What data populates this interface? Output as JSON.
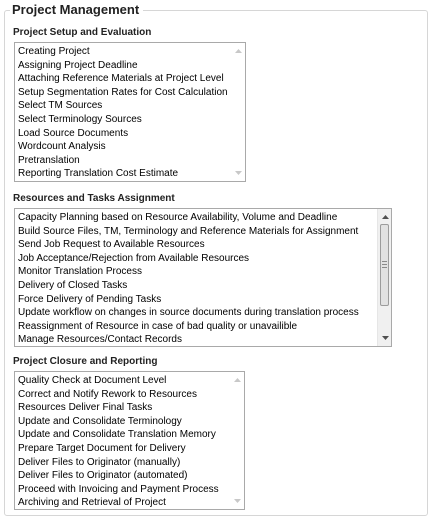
{
  "panel": {
    "legend": "Project Management"
  },
  "sections": [
    {
      "title": "Project Setup and Evaluation",
      "items": [
        "Creating Project",
        "Assigning Project Deadline",
        "Attaching Reference Materials at Project Level",
        "Setup Segmentation Rates for Cost Calculation",
        "Select TM Sources",
        "Select Terminology Sources",
        "Load Source Documents",
        "Wordcount Analysis",
        "Pretranslation",
        "Reporting Translation Cost Estimate"
      ]
    },
    {
      "title": "Resources and Tasks Assignment",
      "items": [
        "Capacity Planning based on Resource Availability, Volume and Deadline",
        "Build Source Files, TM, Terminology and Reference Materials for Assignment",
        "Send Job Request to Available Resources",
        "Job Acceptance/Rejection from Available Resources",
        "Monitor Translation Process",
        "Delivery of Closed Tasks",
        "Force Delivery of Pending Tasks",
        "Update workflow on changes in source documents during translation process",
        "Reassignment of Resource in case of bad quality or unavailible",
        "Manage Resources/Contact Records"
      ]
    },
    {
      "title": "Project Closure and Reporting",
      "items": [
        "Quality Check at Document Level",
        "Correct and Notify Rework to Resources",
        "Resources Deliver Final Tasks",
        "Update and Consolidate Terminology",
        "Update and Consolidate Translation Memory",
        "Prepare Target Document for Delivery",
        "Deliver Files to Originator (manually)",
        "Deliver Files to Originator (automated)",
        "Proceed with Invoicing and Payment Process",
        "Archiving and Retrieval of Project"
      ]
    }
  ],
  "icons": {
    "scroll_up": "scroll-up-arrow-icon",
    "scroll_down": "scroll-down-arrow-icon"
  },
  "colors": {
    "border": "#a9a9a9",
    "fieldset_border": "#d6d6d6",
    "arrow_inactive": "#c8c8c8",
    "arrow_active": "#505050"
  }
}
